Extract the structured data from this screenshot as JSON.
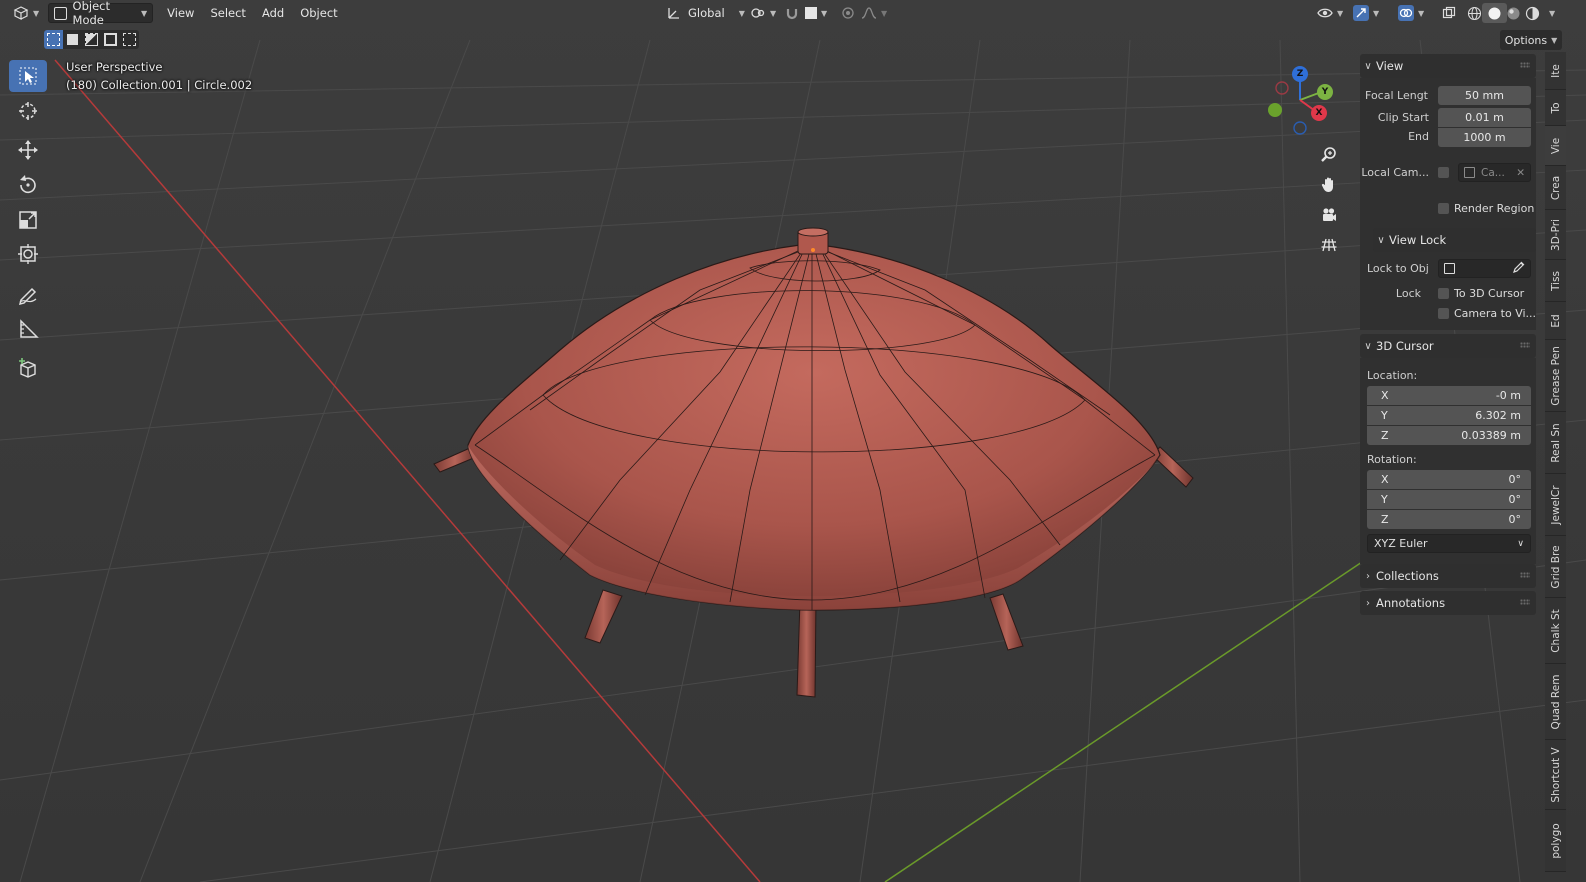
{
  "header": {
    "mode_label": "Object Mode",
    "menus": [
      "View",
      "Select",
      "Add",
      "Object"
    ],
    "transform_orientation": "Global",
    "options_label": "Options"
  },
  "viewport": {
    "perspective_label": "User Perspective",
    "collection_label": "(180) Collection.001 | Circle.002"
  },
  "toolbar": {
    "tools": [
      "select-box",
      "cursor",
      "move",
      "rotate",
      "scale",
      "transform",
      "annotate",
      "measure",
      "add-cube"
    ],
    "active_tool": "select-box"
  },
  "gizmo": {
    "z": "Z",
    "y": "Y",
    "x": "X",
    "z_color": "#2f6fd8",
    "y_color": "#7cb342",
    "x_color": "#e0384a"
  },
  "sidebar": {
    "view": {
      "title": "View",
      "focal_label": "Focal Lengt",
      "focal_value": "50 mm",
      "clip_start_label": "Clip Start",
      "clip_start_value": "0.01 m",
      "end_label": "End",
      "end_value": "1000 m",
      "local_camera_label": "Local Cam...",
      "local_camera_value": "Ca...",
      "render_region_label": "Render Region",
      "view_lock_title": "View Lock",
      "lock_to_obj_label": "Lock to Obj",
      "lock_label": "Lock",
      "to_3d_cursor_label": "To 3D Cursor",
      "camera_to_view_label": "Camera to Vi..."
    },
    "cursor": {
      "title": "3D Cursor",
      "location_label": "Location:",
      "loc_x_label": "X",
      "loc_x": "-0 m",
      "loc_y_label": "Y",
      "loc_y": "6.302 m",
      "loc_z_label": "Z",
      "loc_z": "0.03389 m",
      "rotation_label": "Rotation:",
      "rot_x_label": "X",
      "rot_x": "0°",
      "rot_y_label": "Y",
      "rot_y": "0°",
      "rot_z_label": "Z",
      "rot_z": "0°",
      "rotation_mode": "XYZ Euler"
    },
    "collections_title": "Collections",
    "annotations_title": "Annotations"
  },
  "tabs": [
    "Ite",
    "To",
    "Vie",
    "Crea",
    "3D-Pri",
    "Tiss",
    "Ed",
    "Grease Pen",
    "Real Sn",
    "JewelCr",
    "Grid Bre",
    "Chalk St",
    "Quad Rem",
    "Shortcut V",
    "polygo"
  ],
  "colors": {
    "viewport_bg": "#3a3a3a",
    "active_tool": "#4772b3",
    "mesh_color": "#b05a50",
    "x_axis": "#b53a3a",
    "y_axis": "#6a9a2a"
  }
}
